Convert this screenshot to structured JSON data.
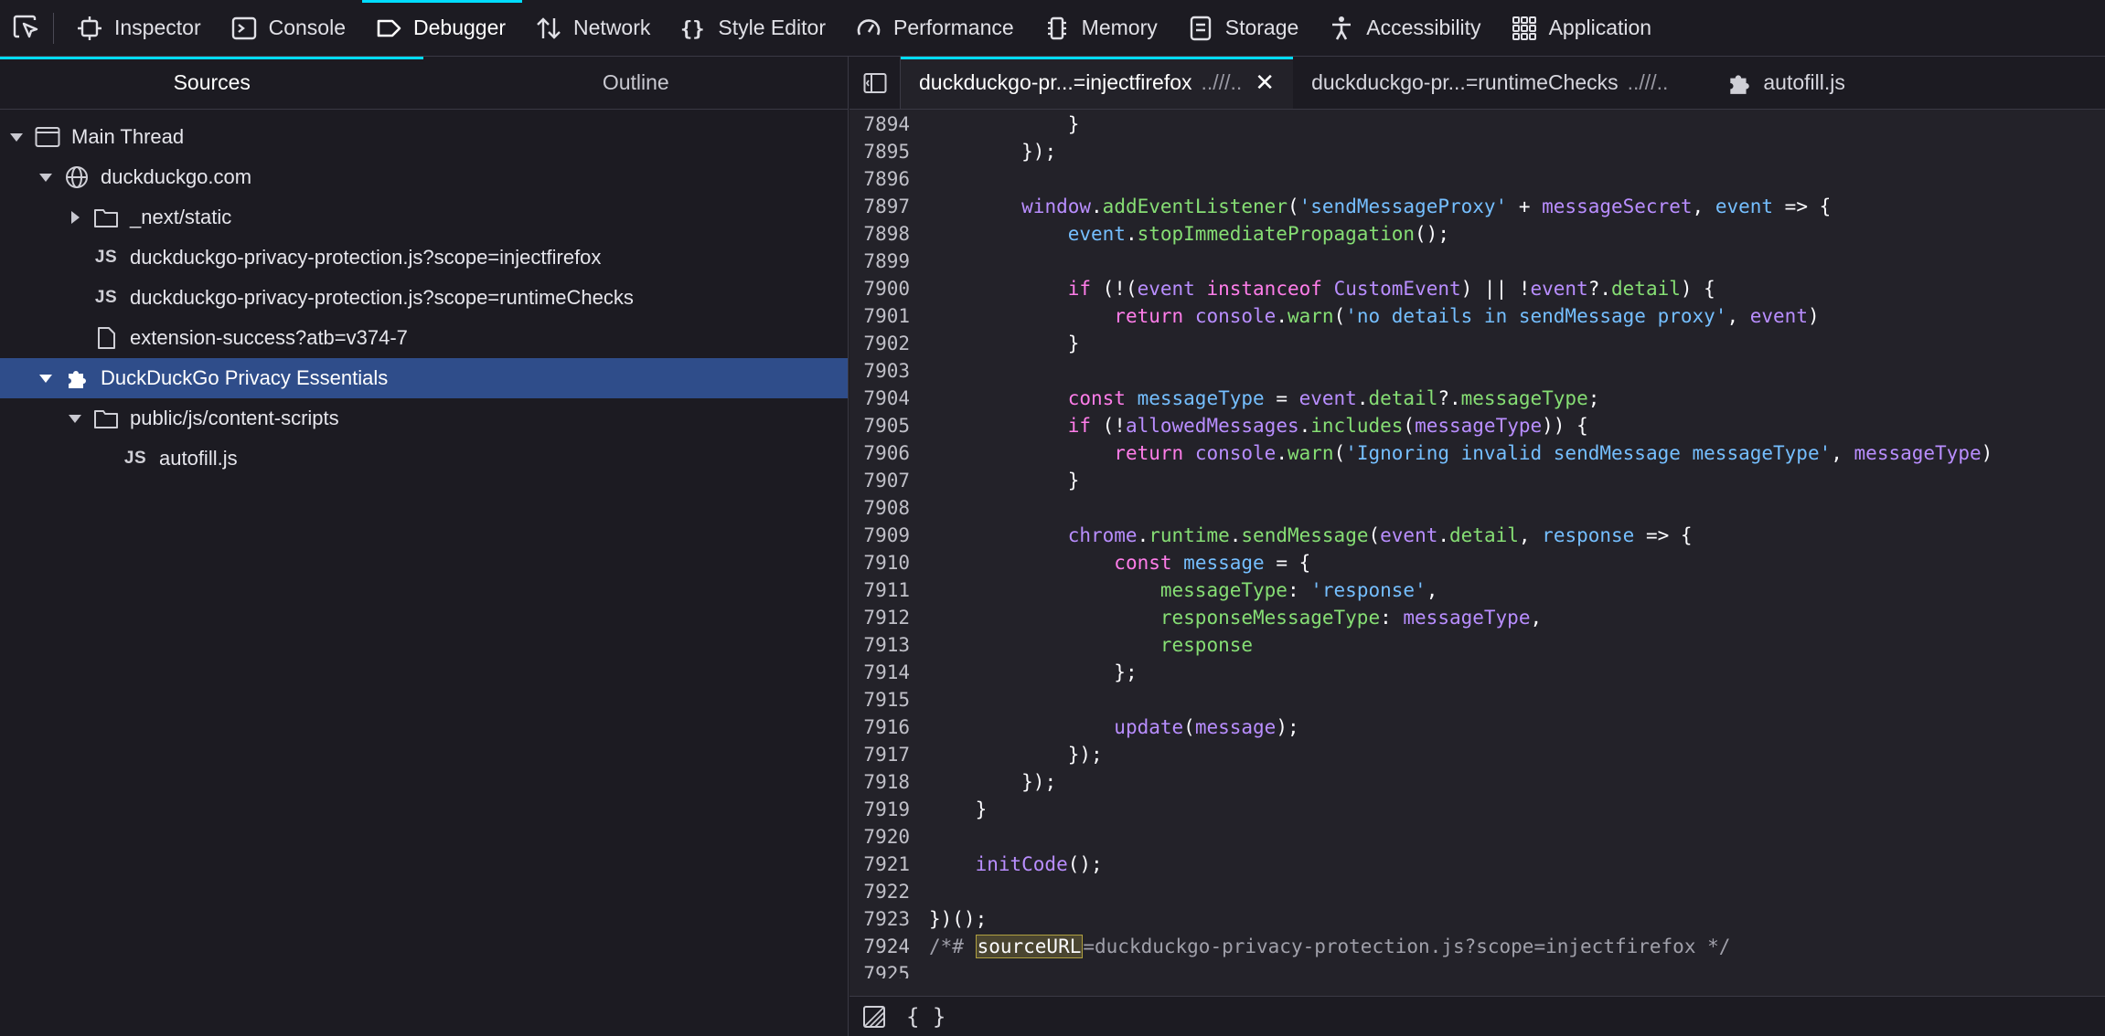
{
  "toolbar": {
    "tools": [
      {
        "label": "Inspector",
        "icon": "inspector-icon"
      },
      {
        "label": "Console",
        "icon": "console-icon"
      },
      {
        "label": "Debugger",
        "icon": "debugger-icon"
      },
      {
        "label": "Network",
        "icon": "network-icon"
      },
      {
        "label": "Style Editor",
        "icon": "style-editor-icon"
      },
      {
        "label": "Performance",
        "icon": "performance-icon"
      },
      {
        "label": "Memory",
        "icon": "memory-icon"
      },
      {
        "label": "Storage",
        "icon": "storage-icon"
      },
      {
        "label": "Accessibility",
        "icon": "accessibility-icon"
      },
      {
        "label": "Application",
        "icon": "application-icon"
      }
    ],
    "selected": "Debugger",
    "accent": "#00ddff"
  },
  "left_panel": {
    "tabs": [
      "Sources",
      "Outline"
    ],
    "tree": [
      {
        "label": "Main Thread"
      },
      {
        "label": "duckduckgo.com"
      },
      {
        "label": "_next/static"
      },
      {
        "label": "duckduckgo-privacy-protection.js?scope=injectfirefox",
        "badge": "JS"
      },
      {
        "label": "duckduckgo-privacy-protection.js?scope=runtimeChecks",
        "badge": "JS"
      },
      {
        "label": "extension-success?atb=v374-7"
      },
      {
        "label": "DuckDuckGo Privacy Essentials"
      },
      {
        "label": "public/js/content-scripts"
      },
      {
        "label": "autofill.js",
        "badge": "JS"
      }
    ],
    "selected_color": "#2f4d8a"
  },
  "editor": {
    "tabs": [
      {
        "name": "duckduckgo-pr...=injectfirefox",
        "path": "..///..",
        "close": "✕"
      },
      {
        "name": "duckduckgo-pr...=runtimeChecks",
        "path": "..///.."
      },
      {
        "name": "autofill.js"
      }
    ],
    "lines": [
      {
        "n": "7894",
        "indent": 12,
        "tokens": [
          [
            "plain",
            "}"
          ]
        ]
      },
      {
        "n": "7895",
        "indent": 8,
        "tokens": [
          [
            "plain",
            "});"
          ]
        ]
      },
      {
        "n": "7896",
        "indent": 0,
        "tokens": []
      },
      {
        "n": "7897",
        "indent": 8,
        "tokens": [
          [
            "fn",
            "window"
          ],
          [
            "plain",
            "."
          ],
          [
            "str",
            "addEventListener"
          ],
          [
            "plain",
            "("
          ],
          [
            "prop",
            "'sendMessageProxy'"
          ],
          [
            "plain",
            " + "
          ],
          [
            "fn",
            "messageSecret"
          ],
          [
            "plain",
            ", "
          ],
          [
            "prop",
            "event"
          ],
          [
            "plain",
            " => {"
          ]
        ]
      },
      {
        "n": "7898",
        "indent": 12,
        "tokens": [
          [
            "prop",
            "event"
          ],
          [
            "plain",
            "."
          ],
          [
            "str",
            "stopImmediatePropagation"
          ],
          [
            "plain",
            "();"
          ]
        ]
      },
      {
        "n": "7899",
        "indent": 0,
        "tokens": []
      },
      {
        "n": "7900",
        "indent": 12,
        "tokens": [
          [
            "kw",
            "if"
          ],
          [
            "plain",
            " (!("
          ],
          [
            "fn",
            "event"
          ],
          [
            "plain",
            " "
          ],
          [
            "kw",
            "instanceof"
          ],
          [
            "plain",
            " "
          ],
          [
            "fn",
            "CustomEvent"
          ],
          [
            "plain",
            ") || !"
          ],
          [
            "fn",
            "event"
          ],
          [
            "plain",
            "?."
          ],
          [
            "str",
            "detail"
          ],
          [
            "plain",
            ") {"
          ]
        ]
      },
      {
        "n": "7901",
        "indent": 16,
        "tokens": [
          [
            "kw",
            "return"
          ],
          [
            "plain",
            " "
          ],
          [
            "fn",
            "console"
          ],
          [
            "plain",
            "."
          ],
          [
            "str",
            "warn"
          ],
          [
            "plain",
            "("
          ],
          [
            "prop",
            "'no details in sendMessage proxy'"
          ],
          [
            "plain",
            ", "
          ],
          [
            "fn",
            "event"
          ],
          [
            "plain",
            ")"
          ]
        ]
      },
      {
        "n": "7902",
        "indent": 12,
        "tokens": [
          [
            "plain",
            "}"
          ]
        ]
      },
      {
        "n": "7903",
        "indent": 0,
        "tokens": []
      },
      {
        "n": "7904",
        "indent": 12,
        "tokens": [
          [
            "kw",
            "const"
          ],
          [
            "plain",
            " "
          ],
          [
            "prop",
            "messageType"
          ],
          [
            "plain",
            " = "
          ],
          [
            "fn",
            "event"
          ],
          [
            "plain",
            "."
          ],
          [
            "str",
            "detail"
          ],
          [
            "plain",
            "?."
          ],
          [
            "str",
            "messageType"
          ],
          [
            "plain",
            ";"
          ]
        ]
      },
      {
        "n": "7905",
        "indent": 12,
        "tokens": [
          [
            "kw",
            "if"
          ],
          [
            "plain",
            " (!"
          ],
          [
            "fn",
            "allowedMessages"
          ],
          [
            "plain",
            "."
          ],
          [
            "str",
            "includes"
          ],
          [
            "plain",
            "("
          ],
          [
            "fn",
            "messageType"
          ],
          [
            "plain",
            ")) {"
          ]
        ]
      },
      {
        "n": "7906",
        "indent": 16,
        "tokens": [
          [
            "kw",
            "return"
          ],
          [
            "plain",
            " "
          ],
          [
            "fn",
            "console"
          ],
          [
            "plain",
            "."
          ],
          [
            "str",
            "warn"
          ],
          [
            "plain",
            "("
          ],
          [
            "prop",
            "'Ignoring invalid sendMessage messageType'"
          ],
          [
            "plain",
            ", "
          ],
          [
            "fn",
            "messageType"
          ],
          [
            "plain",
            ")"
          ]
        ]
      },
      {
        "n": "7907",
        "indent": 12,
        "tokens": [
          [
            "plain",
            "}"
          ]
        ]
      },
      {
        "n": "7908",
        "indent": 0,
        "tokens": []
      },
      {
        "n": "7909",
        "indent": 12,
        "tokens": [
          [
            "fn",
            "chrome"
          ],
          [
            "plain",
            "."
          ],
          [
            "str",
            "runtime"
          ],
          [
            "plain",
            "."
          ],
          [
            "str",
            "sendMessage"
          ],
          [
            "plain",
            "("
          ],
          [
            "fn",
            "event"
          ],
          [
            "plain",
            "."
          ],
          [
            "str",
            "detail"
          ],
          [
            "plain",
            ", "
          ],
          [
            "prop",
            "response"
          ],
          [
            "plain",
            " => {"
          ]
        ]
      },
      {
        "n": "7910",
        "indent": 16,
        "tokens": [
          [
            "kw",
            "const"
          ],
          [
            "plain",
            " "
          ],
          [
            "prop",
            "message"
          ],
          [
            "plain",
            " = {"
          ]
        ]
      },
      {
        "n": "7911",
        "indent": 20,
        "tokens": [
          [
            "str",
            "messageType"
          ],
          [
            "plain",
            ": "
          ],
          [
            "prop",
            "'response'"
          ],
          [
            "plain",
            ","
          ]
        ]
      },
      {
        "n": "7912",
        "indent": 20,
        "tokens": [
          [
            "str",
            "responseMessageType"
          ],
          [
            "plain",
            ": "
          ],
          [
            "fn",
            "messageType"
          ],
          [
            "plain",
            ","
          ]
        ]
      },
      {
        "n": "7913",
        "indent": 20,
        "tokens": [
          [
            "str",
            "response"
          ]
        ]
      },
      {
        "n": "7914",
        "indent": 16,
        "tokens": [
          [
            "plain",
            "};"
          ]
        ]
      },
      {
        "n": "7915",
        "indent": 0,
        "tokens": []
      },
      {
        "n": "7916",
        "indent": 16,
        "tokens": [
          [
            "fn",
            "update"
          ],
          [
            "plain",
            "("
          ],
          [
            "fn",
            "message"
          ],
          [
            "plain",
            ");"
          ]
        ]
      },
      {
        "n": "7917",
        "indent": 12,
        "tokens": [
          [
            "plain",
            "});"
          ]
        ]
      },
      {
        "n": "7918",
        "indent": 8,
        "tokens": [
          [
            "plain",
            "});"
          ]
        ]
      },
      {
        "n": "7919",
        "indent": 4,
        "tokens": [
          [
            "plain",
            "}"
          ]
        ]
      },
      {
        "n": "7920",
        "indent": 0,
        "tokens": []
      },
      {
        "n": "7921",
        "indent": 4,
        "tokens": [
          [
            "fn",
            "initCode"
          ],
          [
            "plain",
            "();"
          ]
        ]
      },
      {
        "n": "7922",
        "indent": 0,
        "tokens": []
      },
      {
        "n": "7923",
        "indent": 0,
        "tokens": [
          [
            "plain",
            "})();"
          ]
        ]
      },
      {
        "n": "7924",
        "indent": 0,
        "tokens": [
          [
            "cm",
            "/*# "
          ],
          [
            "hl",
            "sourceURL"
          ],
          [
            "cm",
            "=duckduckgo-privacy-protection.js?scope=injectfirefox */"
          ]
        ]
      },
      {
        "n": "7925",
        "indent": 0,
        "tokens": []
      }
    ]
  },
  "footer": {
    "pretty_print_label": "{ }"
  }
}
